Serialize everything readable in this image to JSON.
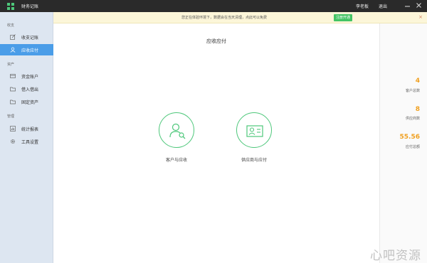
{
  "window": {
    "title": "财务记账",
    "user_name": "李老板",
    "logout_label": "退出"
  },
  "notice": {
    "text": "您正在体验环境下，数据会在当天清理，点此可以免费",
    "register_label": "注册开通",
    "close_glyph": "×"
  },
  "sidebar": {
    "sections": [
      {
        "title": "收支",
        "items": [
          {
            "label": "收支记账",
            "icon": "edit-icon"
          },
          {
            "label": "应收应付",
            "icon": "contact-icon",
            "active": true
          }
        ]
      },
      {
        "title": "资产",
        "items": [
          {
            "label": "资金账户",
            "icon": "card-icon"
          },
          {
            "label": "借入借出",
            "icon": "folder-icon"
          },
          {
            "label": "固定资产",
            "icon": "folder-icon"
          }
        ]
      },
      {
        "title": "管理",
        "items": [
          {
            "label": "统计报表",
            "icon": "chart-icon"
          },
          {
            "label": "工具设置",
            "icon": "gear-icon"
          }
        ]
      }
    ]
  },
  "main": {
    "title": "应收应付",
    "cards": [
      {
        "label": "客户与应收",
        "icon": "customer-search-icon"
      },
      {
        "label": "供应商与应付",
        "icon": "supplier-card-icon"
      }
    ]
  },
  "stats": [
    {
      "value": "4",
      "label": "客户总数"
    },
    {
      "value": "8",
      "label": "供应商数"
    },
    {
      "value": "55.56",
      "label": "应付总额"
    }
  ],
  "colors": {
    "accent_blue": "#4a9de8",
    "accent_green": "#4dc77a",
    "stat_orange": "#f0a020",
    "titlebar": "#2a2a2a"
  },
  "watermark": {
    "text": "心吧资源"
  }
}
